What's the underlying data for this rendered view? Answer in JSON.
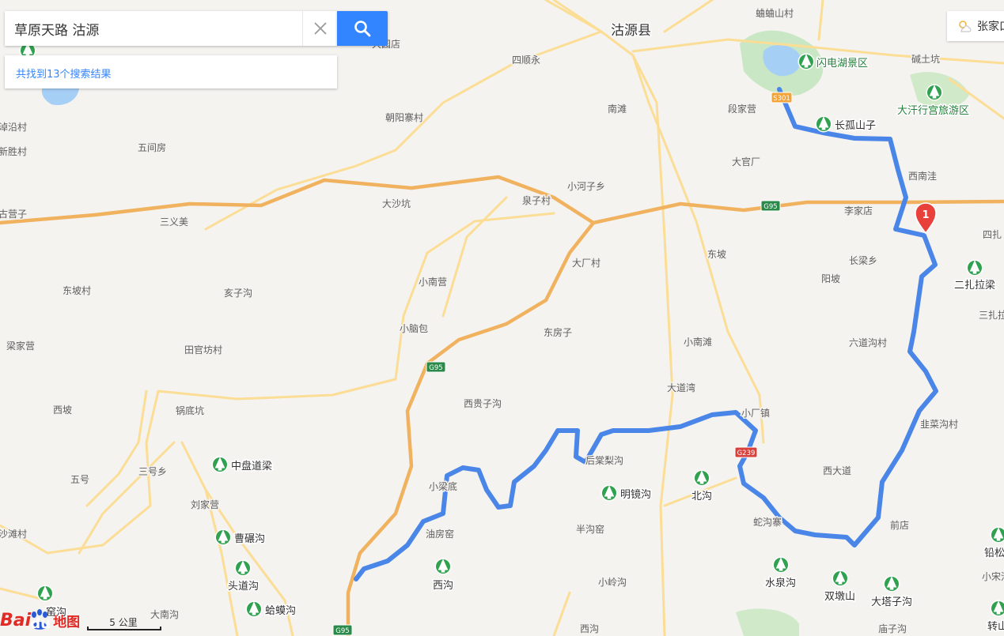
{
  "search": {
    "query": "草原天路 沽源",
    "result_text": "共找到13个搜索结果"
  },
  "weather": {
    "icon": "partly-cloudy-icon",
    "city": "张家口"
  },
  "marker": {
    "label": "1",
    "color": "#e8403a"
  },
  "route_color": "#4a86e8",
  "scale": {
    "label": "5 公里"
  },
  "logo": {
    "brand": "Bai",
    "brand2": "du",
    "suffix": "地图"
  },
  "map": {
    "county_label": "沽源县",
    "road_shields": {
      "s301": "S301",
      "g95_a": "G95",
      "g95_b": "G95",
      "g95_c": "G95",
      "g239": "G239"
    },
    "pois": {
      "shandian_lake": "闪电湖景区",
      "changgu": "长孤山子",
      "dahan": "大汗行宫旅游区",
      "erzha": "二扎拉梁",
      "zhongpan": "中盘道梁",
      "mingjing": "明镜沟",
      "beigou": "北沟",
      "caonian": "曹碾沟",
      "toudao": "头道沟",
      "hama": "蛤蟆沟",
      "xigou": "西沟",
      "shuiquan": "水泉沟",
      "shuangdun": "双墩山",
      "dataz": "大塔子沟",
      "yaogou": "窑沟",
      "qiansong": "铅松",
      "zhuanshan": "转山"
    },
    "places": {
      "dazhou": "大园店",
      "yanyan": "蛐蛐山村",
      "jianzi": "碱土坑",
      "sishun": "四顺永",
      "chaoyang": "朝阳寨村",
      "nantan": "南滩",
      "duanjia": "段家营",
      "yanyanzhen": "淖沿村",
      "xinsheng": "新胜村",
      "wujian": "五间房",
      "daguan": "大官厂",
      "xinan": "西南洼",
      "xiaohe": "小河子乡",
      "quanzi": "泉子村",
      "dasha": "大沙坑",
      "gutzi": "古营子",
      "sanyi": "三义美",
      "lijia": "李家店",
      "sizha": "四扎",
      "dachang": "大厂村",
      "dongpo": "东坡",
      "changliang": "长梁乡",
      "yangpo": "阳坡",
      "xiaonan": "小南营",
      "dongpocun": "东坡村",
      "haizi": "亥子沟",
      "sanzha": "三扎拉",
      "xiaonaobao": "小脑包",
      "dongfang": "东房子",
      "xiaonantan": "小南滩",
      "liudao": "六道沟村",
      "liangjia": "梁家营",
      "tianguan": "田官坊村",
      "xigui": "西贵子沟",
      "dadaowan": "大道湾",
      "xiaochang": "小厂镇",
      "xipo": "西坡",
      "guodi": "锅底坑",
      "feicai": "韭菜沟村",
      "houtang": "后棠梨沟",
      "wuhao": "五号",
      "sanhao": "三号乡",
      "xiaoliang": "小梁底",
      "liujia": "刘家营",
      "xida": "西大道",
      "shegou": "蛇沟寨",
      "qiandian": "前店",
      "shatan": "沙滩村",
      "youfang": "油房窑",
      "banyao": "半沟窑",
      "xiaoling": "小岭沟",
      "xiaosong": "小宋沟",
      "danan": "大南沟",
      "xigou2": "西沟",
      "miaozi": "庙子沟"
    }
  }
}
